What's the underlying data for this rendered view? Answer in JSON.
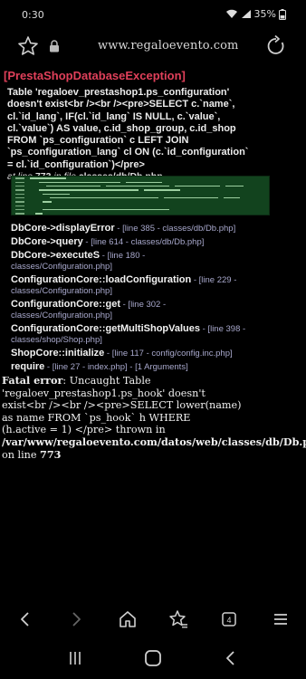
{
  "status_bar": {
    "time": "0:30",
    "battery": "35%"
  },
  "browser": {
    "url": "www.regaloevento.com"
  },
  "error": {
    "title": "[PrestaShopDatabaseException]",
    "message_lines": [
      "Table 'regaloev_prestashop1.ps_configuration'",
      "doesn't exist<br /><br /><pre>SELECT c.`name`,",
      "cl.`id_lang`, IF(cl.`id_lang` IS NULL, c.`value`,",
      "cl.`value`) AS value, c.id_shop_group, c.id_shop",
      "FROM `ps_configuration` c LEFT JOIN",
      "`ps_configuration_lang` cl ON (c.`id_configuration`",
      "= cl.`id_configuration`)</pre>"
    ],
    "at_line": "at line",
    "line_number": "773",
    "in_file": "in file",
    "file": "classes/db/Db.php"
  },
  "stack_trace": [
    {
      "fn": "DbCore->displayError",
      "loc": " - [line 385 - classes/db/Db.php]"
    },
    {
      "fn": "DbCore->query",
      "loc": " - [line 614 - classes/db/Db.php]"
    },
    {
      "fn": "DbCore->executeS",
      "loc": " - [line 180 -",
      "loc2": "classes/Configuration.php]"
    },
    {
      "fn": "ConfigurationCore::loadConfiguration",
      "loc": " - [line 229 -",
      "loc2": "classes/Configuration.php]"
    },
    {
      "fn": "ConfigurationCore::get",
      "loc": " - [line 302 -",
      "loc2": "classes/Configuration.php]"
    },
    {
      "fn": "ConfigurationCore::getMultiShopValues",
      "loc": " - [line 398 -",
      "loc2": "classes/shop/Shop.php]"
    },
    {
      "fn": "ShopCore::initialize",
      "loc": " - [line 117 - config/config.inc.php]"
    },
    {
      "fn": "require",
      "loc": " - [line 27 - index.php] - [1 Arguments]"
    }
  ],
  "fatal": {
    "label": "Fatal error",
    "message_lines": [
      ": Uncaught Table",
      "'regaloev_prestashop1.ps_hook' doesn't",
      "exist<br /><br /><pre>SELECT lower(name)",
      "as name FROM `ps_hook` h WHERE",
      "(h.active = 1) </pre> thrown in"
    ],
    "path": "/var/www/regaloevento.com/datos/web/classes/db/Db.php",
    "on_line": "on line",
    "line_number": "773"
  },
  "bottom_nav": {
    "tabs_count": "4"
  }
}
